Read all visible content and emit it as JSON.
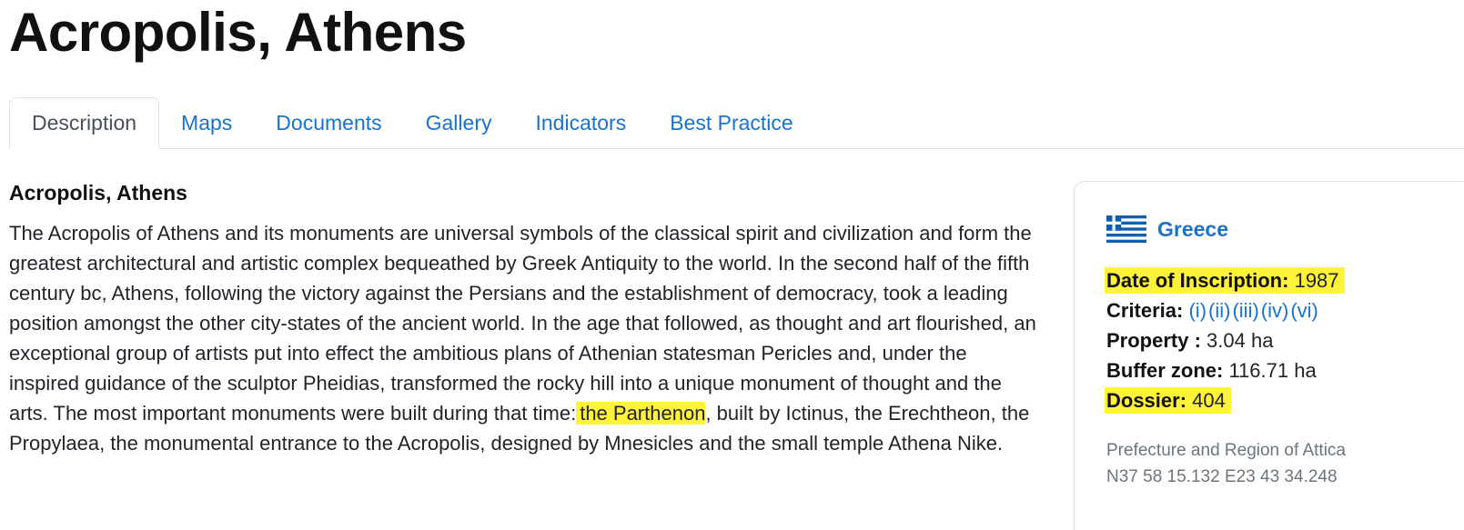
{
  "page": {
    "title": "Acropolis, Athens"
  },
  "tabs": [
    {
      "label": "Description",
      "active": true
    },
    {
      "label": "Maps",
      "active": false
    },
    {
      "label": "Documents",
      "active": false
    },
    {
      "label": "Gallery",
      "active": false
    },
    {
      "label": "Indicators",
      "active": false
    },
    {
      "label": "Best Practice",
      "active": false
    }
  ],
  "main": {
    "section_title": "Acropolis, Athens",
    "description": {
      "before_highlight": "The Acropolis of Athens and its monuments are universal symbols of the classical spirit and civilization and form the greatest architectural and artistic complex bequeathed by Greek Antiquity to the world. In the second half of the fifth century bc, Athens, following the victory against the Persians and the establishment of democracy, took a leading position amongst the other city-states of the ancient world. In the age that followed, as thought and art flourished, an exceptional group of artists put into effect the ambitious plans of Athenian statesman Pericles and, under the inspired guidance of the sculptor Pheidias, transformed the rocky hill into a unique monument of thought and the arts. The most important monuments were built during that time:",
      "highlight": "the Parthenon",
      "after_highlight": ", built by Ictinus, the Erechtheon, the Propylaea, the monumental entrance to the Acropolis, designed by Mnesicles and the small temple Athena Nike."
    }
  },
  "sidebar": {
    "country": "Greece",
    "flag_icon": "greece-flag-icon",
    "highlight_color": "#fff23a",
    "link_color": "#1a73c8",
    "facts": {
      "date_label": "Date of Inscription:",
      "date_value": "1987",
      "criteria_label": "Criteria:",
      "criteria": [
        "(i)",
        "(ii)",
        "(iii)",
        "(iv)",
        "(vi)"
      ],
      "property_label": "Property :",
      "property_value": "3.04 ha",
      "buffer_label": "Buffer zone:",
      "buffer_value": "116.71 ha",
      "dossier_label": "Dossier:",
      "dossier_value": "404"
    },
    "location": {
      "region": "Prefecture and Region of Attica",
      "coordinates": "N37 58 15.132 E23 43 34.248"
    }
  }
}
